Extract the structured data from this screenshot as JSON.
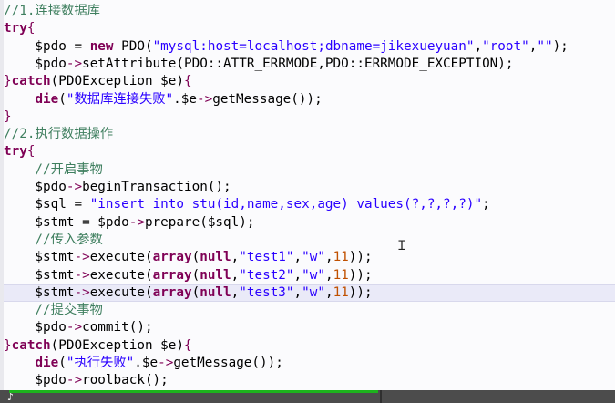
{
  "editor": {
    "lines": [
      [
        {
          "t": "//1.连接数据库",
          "c": "cmt"
        }
      ],
      [
        {
          "t": "try",
          "c": "kw"
        },
        {
          "t": "{",
          "c": "brc"
        }
      ],
      [
        {
          "t": "    $pdo",
          "c": "var"
        },
        {
          "t": " = ",
          "c": "op"
        },
        {
          "t": "new",
          "c": "kw"
        },
        {
          "t": " PDO(",
          "c": "fn"
        },
        {
          "t": "\"mysql:host=localhost;dbname=jikexueyuan\"",
          "c": "str"
        },
        {
          "t": ",",
          "c": "op"
        },
        {
          "t": "\"root\"",
          "c": "str"
        },
        {
          "t": ",",
          "c": "op"
        },
        {
          "t": "\"\"",
          "c": "str"
        },
        {
          "t": ");",
          "c": "op"
        }
      ],
      [
        {
          "t": "    $pdo",
          "c": "var"
        },
        {
          "t": "->",
          "c": "arrow"
        },
        {
          "t": "setAttribute(PDO::ATTR_ERRMODE,PDO::ERRMODE_EXCEPTION);",
          "c": "fn"
        }
      ],
      [
        {
          "t": "}",
          "c": "brc"
        },
        {
          "t": "catch",
          "c": "kw"
        },
        {
          "t": "(PDOException $e)",
          "c": "fn"
        },
        {
          "t": "{",
          "c": "brc"
        }
      ],
      [
        {
          "t": "    ",
          "c": "op"
        },
        {
          "t": "die",
          "c": "kw"
        },
        {
          "t": "(",
          "c": "op"
        },
        {
          "t": "\"数据库连接失败\"",
          "c": "str"
        },
        {
          "t": ".$e",
          "c": "var"
        },
        {
          "t": "->",
          "c": "arrow"
        },
        {
          "t": "getMessage());",
          "c": "fn"
        }
      ],
      [
        {
          "t": "}",
          "c": "brc"
        }
      ],
      [
        {
          "t": "//2.执行数据操作",
          "c": "cmt"
        }
      ],
      [
        {
          "t": "try",
          "c": "kw"
        },
        {
          "t": "{",
          "c": "brc"
        }
      ],
      [
        {
          "t": "    //开启事物",
          "c": "cmt"
        }
      ],
      [
        {
          "t": "    $pdo",
          "c": "var"
        },
        {
          "t": "->",
          "c": "arrow"
        },
        {
          "t": "beginTransaction();",
          "c": "fn"
        }
      ],
      [
        {
          "t": "    $sql",
          "c": "var"
        },
        {
          "t": " = ",
          "c": "op"
        },
        {
          "t": "\"insert into stu(id,name,sex,age) values(?,?,?,?)\"",
          "c": "str"
        },
        {
          "t": ";",
          "c": "op"
        }
      ],
      [
        {
          "t": "    $stmt",
          "c": "var"
        },
        {
          "t": " = ",
          "c": "op"
        },
        {
          "t": "$pdo",
          "c": "var"
        },
        {
          "t": "->",
          "c": "arrow"
        },
        {
          "t": "prepare($sql);",
          "c": "fn"
        }
      ],
      [
        {
          "t": "    //传入参数",
          "c": "cmt"
        }
      ],
      [
        {
          "t": "    $stmt",
          "c": "var"
        },
        {
          "t": "->",
          "c": "arrow"
        },
        {
          "t": "execute(",
          "c": "fn"
        },
        {
          "t": "array",
          "c": "kw"
        },
        {
          "t": "(",
          "c": "op"
        },
        {
          "t": "null",
          "c": "kw"
        },
        {
          "t": ",",
          "c": "op"
        },
        {
          "t": "\"test1\"",
          "c": "str"
        },
        {
          "t": ",",
          "c": "op"
        },
        {
          "t": "\"w\"",
          "c": "str"
        },
        {
          "t": ",",
          "c": "op"
        },
        {
          "t": "11",
          "c": "num"
        },
        {
          "t": "));",
          "c": "op"
        }
      ],
      [
        {
          "t": "    $stmt",
          "c": "var"
        },
        {
          "t": "->",
          "c": "arrow"
        },
        {
          "t": "execute(",
          "c": "fn"
        },
        {
          "t": "array",
          "c": "kw"
        },
        {
          "t": "(",
          "c": "op"
        },
        {
          "t": "null",
          "c": "kw"
        },
        {
          "t": ",",
          "c": "op"
        },
        {
          "t": "\"test2\"",
          "c": "str"
        },
        {
          "t": ",",
          "c": "op"
        },
        {
          "t": "\"w\"",
          "c": "str"
        },
        {
          "t": ",",
          "c": "op"
        },
        {
          "t": "11",
          "c": "num"
        },
        {
          "t": "));",
          "c": "op"
        }
      ],
      [
        {
          "t": "    $stmt",
          "c": "var"
        },
        {
          "t": "->",
          "c": "arrow"
        },
        {
          "t": "execute(",
          "c": "fn"
        },
        {
          "t": "array",
          "c": "kw"
        },
        {
          "t": "(",
          "c": "op"
        },
        {
          "t": "null",
          "c": "kw"
        },
        {
          "t": ",",
          "c": "op"
        },
        {
          "t": "\"test3\"",
          "c": "str"
        },
        {
          "t": ",",
          "c": "op"
        },
        {
          "t": "\"w\"",
          "c": "str"
        },
        {
          "t": ",",
          "c": "op"
        },
        {
          "t": "11",
          "c": "num"
        },
        {
          "t": "));",
          "c": "op"
        }
      ],
      [
        {
          "t": "    //提交事物",
          "c": "cmt"
        }
      ],
      [
        {
          "t": "    $pdo",
          "c": "var"
        },
        {
          "t": "->",
          "c": "arrow"
        },
        {
          "t": "commit();",
          "c": "fn"
        }
      ],
      [
        {
          "t": "}",
          "c": "brc"
        },
        {
          "t": "catch",
          "c": "kw"
        },
        {
          "t": "(PDOException $e)",
          "c": "fn"
        },
        {
          "t": "{",
          "c": "brc"
        }
      ],
      [
        {
          "t": "    ",
          "c": "op"
        },
        {
          "t": "die",
          "c": "kw"
        },
        {
          "t": "(",
          "c": "op"
        },
        {
          "t": "\"执行失败\"",
          "c": "str"
        },
        {
          "t": ".$e",
          "c": "var"
        },
        {
          "t": "->",
          "c": "arrow"
        },
        {
          "t": "getMessage());",
          "c": "fn"
        }
      ],
      [
        {
          "t": "    $pdo",
          "c": "var"
        },
        {
          "t": "->",
          "c": "arrow"
        },
        {
          "t": "roolback();",
          "c": "fn"
        }
      ]
    ],
    "current_line_index": 16,
    "colors": {
      "keyword": "#7f0055",
      "string": "#2a00ff",
      "number": "#c05000",
      "comment": "#3f7f5f",
      "current_line": "#eaeaf8",
      "status_progress": "#1db31d",
      "status_bar": "#4c4c4c"
    }
  },
  "status": {
    "cursor_mark": "♪"
  }
}
